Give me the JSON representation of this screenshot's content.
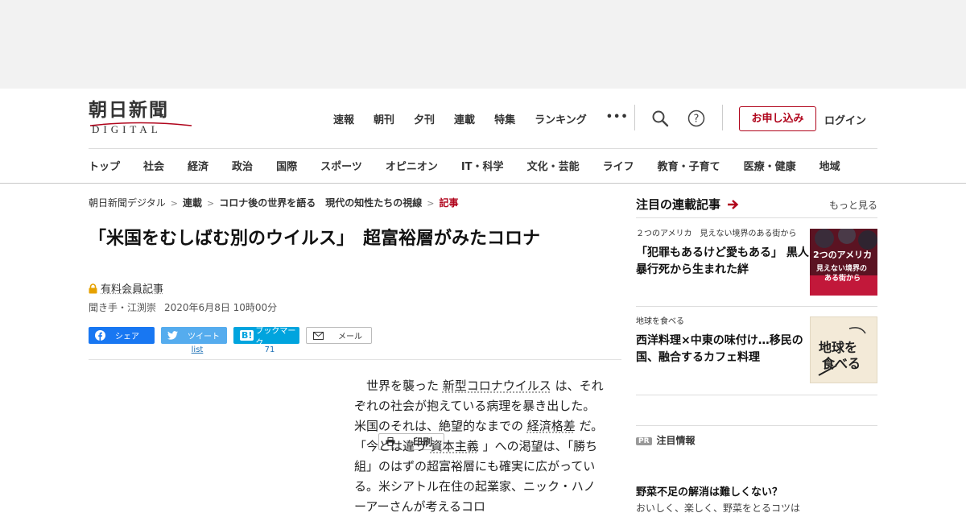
{
  "logo": {
    "kanji": "朝日新聞",
    "latin": "DIGITAL"
  },
  "topnav": [
    "速報",
    "朝刊",
    "夕刊",
    "連載",
    "特集",
    "ランキング",
    "•••"
  ],
  "header": {
    "apply": "お申し込み",
    "login": "ログイン"
  },
  "catnav": [
    "トップ",
    "社会",
    "経済",
    "政治",
    "国際",
    "スポーツ",
    "オピニオン",
    "IT・科学",
    "文化・芸能",
    "ライフ",
    "教育・子育て",
    "医療・健康",
    "地域"
  ],
  "breadcrumb": [
    "朝日新聞デジタル",
    "連載",
    "コロナ後の世界を語る　現代の知性たちの視線",
    "記事"
  ],
  "article": {
    "title": "「米国をむしばむ別のウイルス」　超富裕層がみたコロナ",
    "members": "有料会員記事",
    "author": "聞き手・江渕崇",
    "date": "2020年6月8日 10時00分",
    "share": {
      "facebook": "シェア",
      "twitter": "ツイート",
      "hatena": "ブックマーク",
      "mail": "メール",
      "print": "印刷",
      "twitter_count": "list",
      "hatena_count": "71"
    },
    "body": [
      "世界を襲った ",
      "新型コロナウイルス",
      " は、それぞれの社会が抱えている病理を暴き出した。米国のそれは、絶望的なまでの ",
      "経済格差",
      " だ。「今とは違う ",
      "資本主義",
      " 」への渇望は、「勝ち組」のはずの超富裕層にも確実に広がっている。米シアトル在住の起業家、ニック・ハノーアーさんが考えるコロ"
    ]
  },
  "sidebar": {
    "title": "注目の連載記事",
    "more": "もっと見る",
    "cards": [
      {
        "kicker": "２つのアメリカ　見えない境界のある街から",
        "headline": "「犯罪もあるけど愛もある」 黒人暴行死から生まれた絆",
        "thumb_text_1": "2つのアメリカ",
        "thumb_text_2": "見えない境界の",
        "thumb_text_3": "ある街から"
      },
      {
        "kicker": "地球を食べる",
        "headline": "西洋料理×中東の味付け…移民の国、融合するカフェ料理",
        "thumb_text_1": "地球を",
        "thumb_text_2": "食べる"
      }
    ],
    "pr_badge": "PR",
    "pr_label": "注目情報",
    "pr_headline": "野菜不足の解消は難しくない？",
    "pr_sub": "おいしく、楽しく、野菜をとるコツは"
  },
  "colors": {
    "brand_red": "#b0051c",
    "facebook": "#1877f2",
    "twitter": "#55acee",
    "hatena": "#00a4de"
  }
}
